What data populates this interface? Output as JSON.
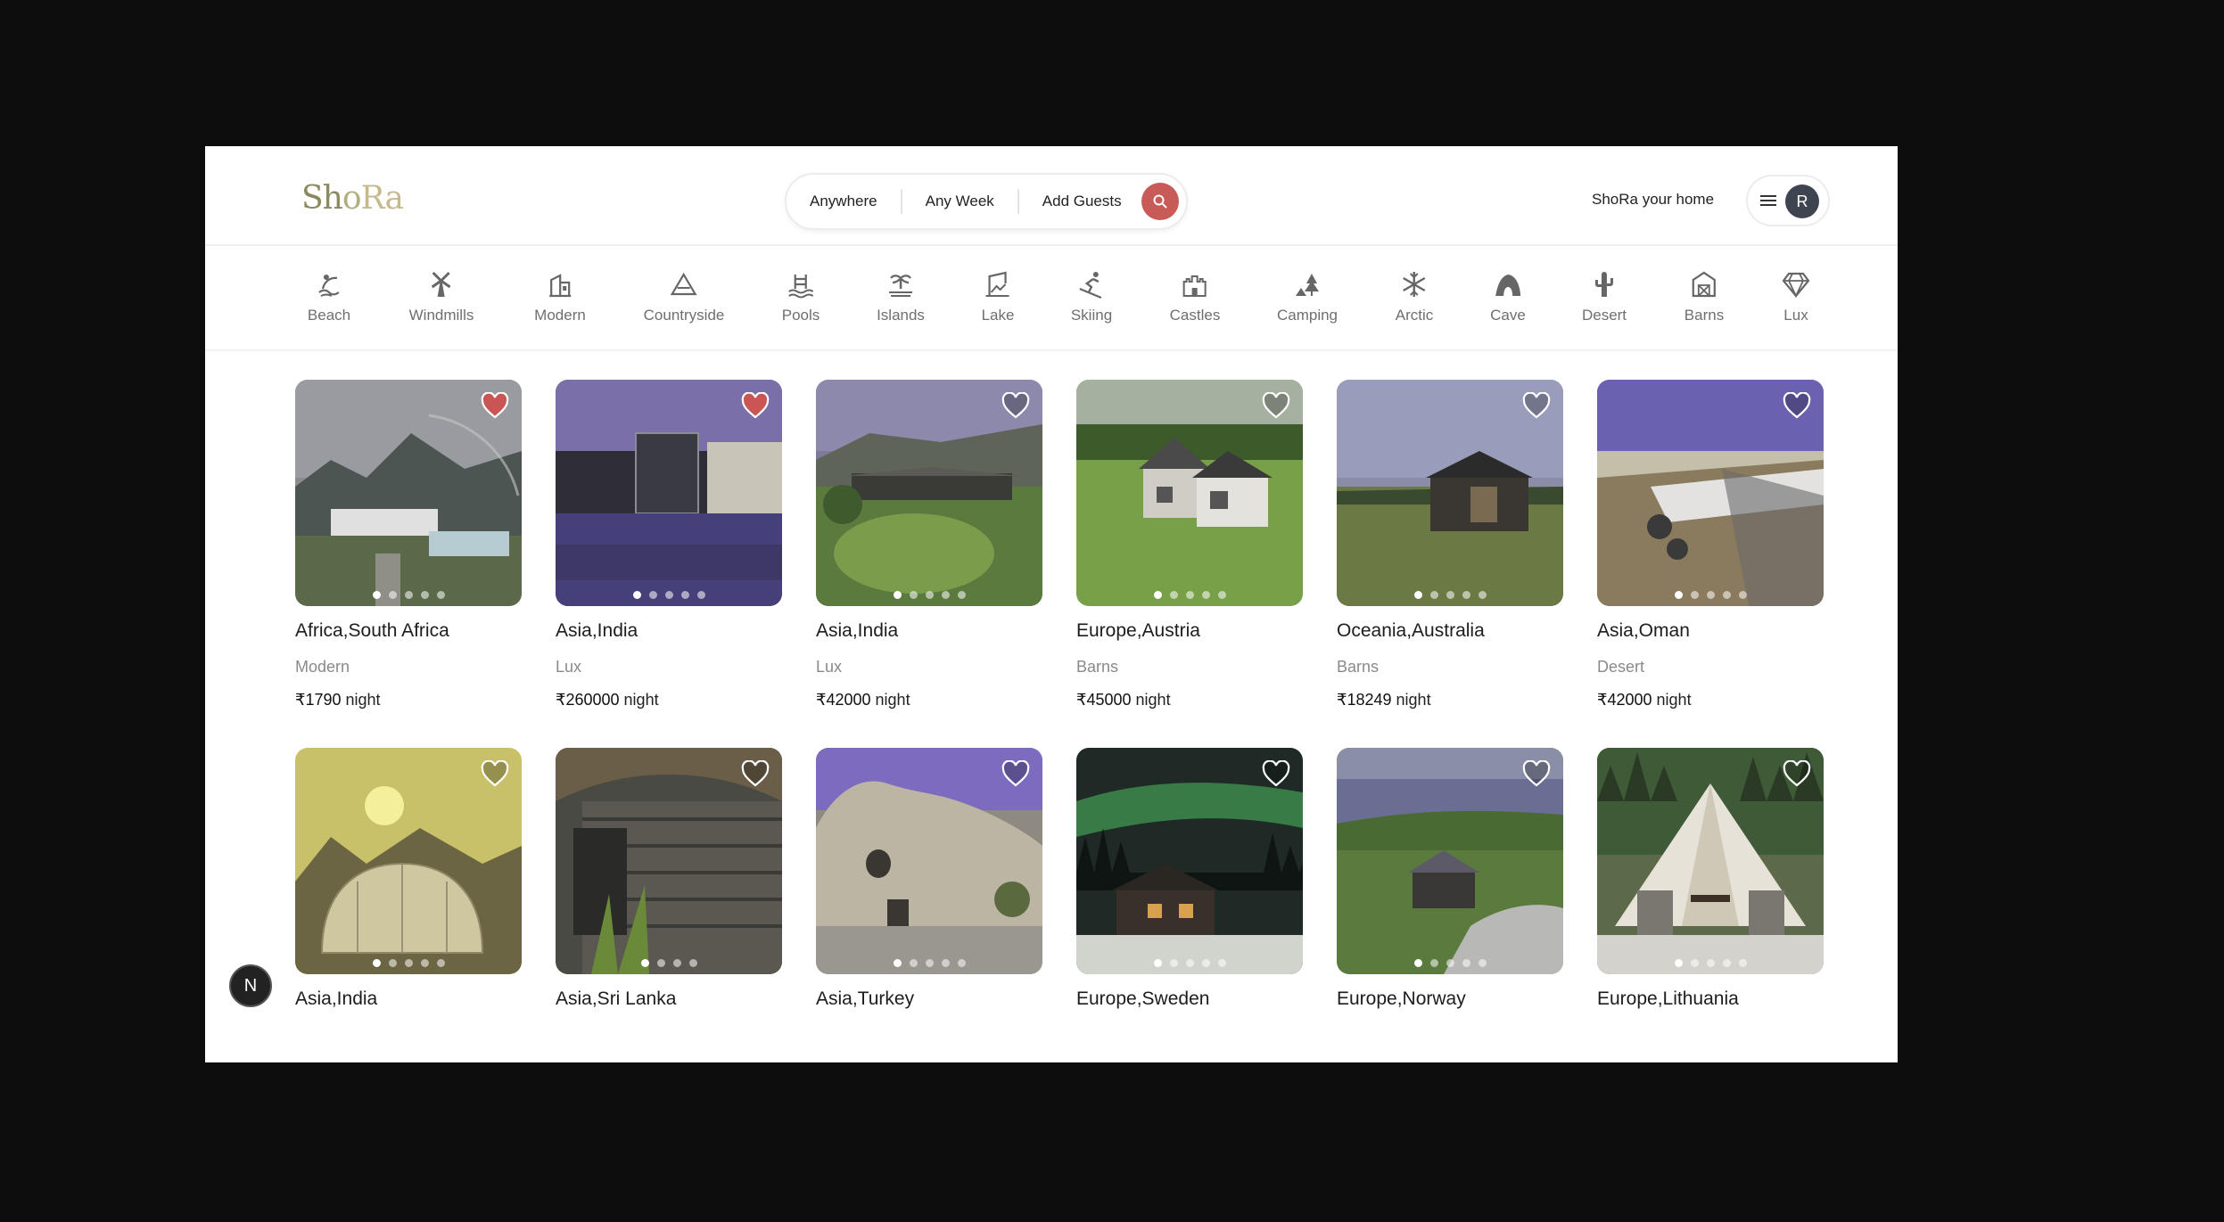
{
  "brand": {
    "logo_text": "ShoRa"
  },
  "search": {
    "where": "Anywhere",
    "when": "Any Week",
    "guests": "Add Guests",
    "button_icon": "search-icon",
    "accent": "#c85a57"
  },
  "header": {
    "host_link": "ShoRa your home",
    "avatar_initial": "R"
  },
  "categories": [
    {
      "label": "Beach",
      "icon": "beach-icon"
    },
    {
      "label": "Windmills",
      "icon": "windmill-icon"
    },
    {
      "label": "Modern",
      "icon": "modern-building-icon"
    },
    {
      "label": "Countryside",
      "icon": "mountain-icon"
    },
    {
      "label": "Pools",
      "icon": "pool-icon"
    },
    {
      "label": "Islands",
      "icon": "island-icon"
    },
    {
      "label": "Lake",
      "icon": "lake-icon"
    },
    {
      "label": "Skiing",
      "icon": "skiing-icon"
    },
    {
      "label": "Castles",
      "icon": "castle-icon"
    },
    {
      "label": "Camping",
      "icon": "camping-icon"
    },
    {
      "label": "Arctic",
      "icon": "snowflake-icon"
    },
    {
      "label": "Cave",
      "icon": "cave-icon"
    },
    {
      "label": "Desert",
      "icon": "cactus-icon"
    },
    {
      "label": "Barns",
      "icon": "barn-icon"
    },
    {
      "label": "Lux",
      "icon": "diamond-icon"
    }
  ],
  "listings": [
    {
      "location": "Africa,South Africa",
      "category": "Modern",
      "price": "₹1790",
      "unit": "night",
      "favorited": true
    },
    {
      "location": "Asia,India",
      "category": "Lux",
      "price": "₹260000",
      "unit": "night",
      "favorited": true
    },
    {
      "location": "Asia,India",
      "category": "Lux",
      "price": "₹42000",
      "unit": "night",
      "favorited": false
    },
    {
      "location": "Europe,Austria",
      "category": "Barns",
      "price": "₹45000",
      "unit": "night",
      "favorited": false
    },
    {
      "location": "Oceania,Australia",
      "category": "Barns",
      "price": "₹18249",
      "unit": "night",
      "favorited": false
    },
    {
      "location": "Asia,Oman",
      "category": "Desert",
      "price": "₹42000",
      "unit": "night",
      "favorited": false
    },
    {
      "location": "Asia,India",
      "favorited": false
    },
    {
      "location": "Asia,Sri Lanka",
      "favorited": false
    },
    {
      "location": "Asia,Turkey",
      "favorited": false
    },
    {
      "location": "Europe,Sweden",
      "favorited": false
    },
    {
      "location": "Europe,Norway",
      "favorited": false
    },
    {
      "location": "Europe,Lithuania",
      "favorited": false
    }
  ],
  "floating_badge": {
    "letter": "N"
  },
  "colors": {
    "favorite_heart": "#c95555",
    "heart_outline": "#ffffff"
  }
}
